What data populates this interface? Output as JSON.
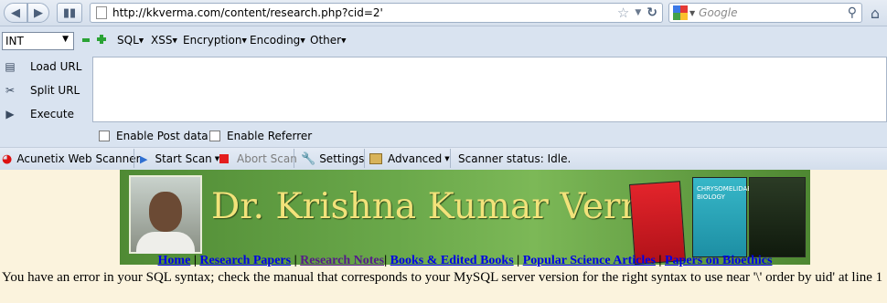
{
  "browser": {
    "url": "http://kkverma.com/content/research.php?cid=2'",
    "search_placeholder": "Google"
  },
  "hackbar": {
    "select_value": "INT",
    "menus": [
      "SQL",
      "XSS",
      "Encryption",
      "Encoding",
      "Other"
    ],
    "buttons": [
      "Load URL",
      "Split URL",
      "Execute"
    ],
    "checkboxes": [
      "Enable Post data",
      "Enable Referrer"
    ]
  },
  "acunetix": {
    "title": "Acunetix Web Scanner",
    "start_scan": "Start Scan",
    "abort_scan": "Abort Scan",
    "settings": "Settings",
    "advanced": "Advanced",
    "status": "Scanner status: Idle."
  },
  "page": {
    "banner_title": "Dr. Krishna Kumar Verma",
    "book_title": "CHRYSOMELIDAE BIOLOGY",
    "nav_links": [
      "Home",
      "Research Papers",
      "Research Notes",
      "Books & Edited Books",
      "Popular Science Articles",
      "Papers on Bioethics"
    ],
    "error_message": "You have an error in your SQL syntax; check the manual that corresponds to your MySQL server version for the right syntax to use near '\\' order by uid' at line 1"
  },
  "colors": {
    "page_background": "#fbf3dd",
    "toolbar_background": "#d9e3f0",
    "link": "#0000e6",
    "visited_link": "#551a8b",
    "banner_title": "#f2e27a"
  }
}
